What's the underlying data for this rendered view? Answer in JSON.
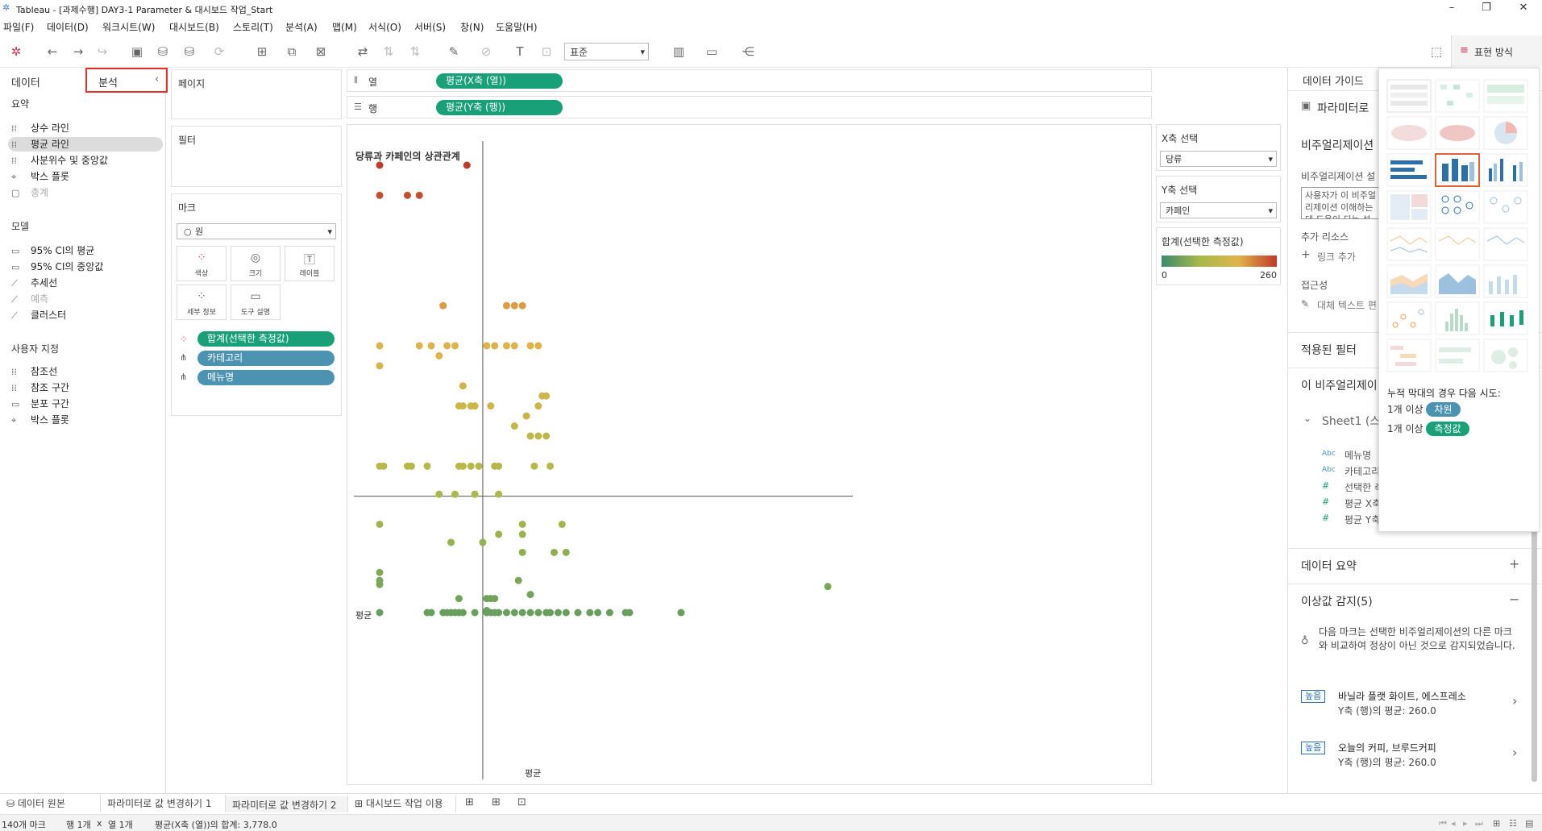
{
  "window": {
    "title": "Tableau - [과제수행] DAY3-1 Parameter & 대시보드 작업_Start"
  },
  "menu": [
    "파일(F)",
    "데이터(D)",
    "워크시트(W)",
    "대시보드(B)",
    "스토리(T)",
    "분석(A)",
    "맵(M)",
    "서식(O)",
    "서버(S)",
    "창(N)",
    "도움말(H)"
  ],
  "toolbar": {
    "fit_select": "표준",
    "show_me_label": "표현 방식"
  },
  "left_panel": {
    "tab_data": "데이터",
    "tab_analysis": "분석",
    "sections": [
      {
        "title": "요약",
        "items": [
          "상수 라인",
          "평균 라인",
          "사분위수 및 중앙값",
          "박스 플롯",
          "총계"
        ]
      },
      {
        "title": "모델",
        "items": [
          "95% CI의 평균",
          "95% CI의 중앙값",
          "추세선",
          "예측",
          "클러스터"
        ]
      },
      {
        "title": "사용자 지정",
        "items": [
          "참조선",
          "참조 구간",
          "분포 구간",
          "박스 플롯"
        ]
      }
    ]
  },
  "cards": {
    "pages_title": "페이지",
    "filters_title": "필터",
    "marks_title": "마크",
    "mark_type": "원",
    "mark_buttons": [
      "색상",
      "크기",
      "레이블",
      "세부 정보",
      "도구 설명"
    ],
    "mark_pills": [
      "합계(선택한 측정값)",
      "카테고리",
      "메뉴명"
    ]
  },
  "shelves": {
    "columns_label": "열",
    "rows_label": "행",
    "columns_pill": "평균(X축 (열))",
    "rows_pill": "평균(Y축 (행))"
  },
  "viz": {
    "title": "당류과 카페인의 상관관계",
    "avg_label_h": "평균",
    "avg_label_v": "평균"
  },
  "chart_data": {
    "type": "scatter",
    "title": "당류과 카페인의 상관관계",
    "xlabel": "",
    "ylabel": "",
    "reference_lines": {
      "horizontal": "평균",
      "vertical": "평균"
    },
    "color_legend": {
      "title": "합계(선택한 측정값)",
      "min": 0,
      "max": 260,
      "colors": [
        "#3a8a6e",
        "#a7b94a",
        "#e0b44a",
        "#c0392b"
      ]
    },
    "points": [
      [
        0,
        260
      ],
      [
        22,
        260
      ],
      [
        0,
        245
      ],
      [
        7,
        245
      ],
      [
        10,
        245
      ],
      [
        16,
        190
      ],
      [
        32,
        190
      ],
      [
        34,
        190
      ],
      [
        36,
        190
      ],
      [
        0,
        170
      ],
      [
        10,
        170
      ],
      [
        13,
        170
      ],
      [
        15,
        165
      ],
      [
        17,
        170
      ],
      [
        19,
        170
      ],
      [
        27,
        170
      ],
      [
        29,
        170
      ],
      [
        32,
        170
      ],
      [
        34,
        170
      ],
      [
        38,
        170
      ],
      [
        40,
        170
      ],
      [
        0,
        160
      ],
      [
        21,
        150
      ],
      [
        20,
        140
      ],
      [
        21,
        140
      ],
      [
        23,
        140
      ],
      [
        24,
        140
      ],
      [
        28,
        140
      ],
      [
        37,
        135
      ],
      [
        40,
        140
      ],
      [
        41,
        145
      ],
      [
        42,
        145
      ],
      [
        34,
        130
      ],
      [
        38,
        125
      ],
      [
        40,
        125
      ],
      [
        42,
        125
      ],
      [
        0,
        110
      ],
      [
        1,
        110
      ],
      [
        7,
        110
      ],
      [
        8,
        110
      ],
      [
        12,
        110
      ],
      [
        20,
        110
      ],
      [
        21,
        110
      ],
      [
        23,
        110
      ],
      [
        25,
        110
      ],
      [
        29,
        110
      ],
      [
        30,
        110
      ],
      [
        39,
        110
      ],
      [
        43,
        110
      ],
      [
        15,
        96
      ],
      [
        19,
        96
      ],
      [
        24,
        96
      ],
      [
        30,
        96
      ],
      [
        0,
        81
      ],
      [
        36,
        81
      ],
      [
        46,
        81
      ],
      [
        30,
        76
      ],
      [
        36,
        76
      ],
      [
        18,
        72
      ],
      [
        26,
        72
      ],
      [
        36,
        67
      ],
      [
        44,
        67
      ],
      [
        47,
        67
      ],
      [
        0,
        57
      ],
      [
        0,
        53
      ],
      [
        0,
        51
      ],
      [
        35,
        53
      ],
      [
        113,
        50
      ],
      [
        38,
        46
      ],
      [
        20,
        44
      ],
      [
        27,
        44
      ],
      [
        28,
        44
      ],
      [
        29,
        44
      ],
      [
        27,
        38
      ],
      [
        0,
        37
      ],
      [
        12,
        37
      ],
      [
        13,
        37
      ],
      [
        16,
        37
      ],
      [
        17,
        37
      ],
      [
        18,
        37
      ],
      [
        19,
        37
      ],
      [
        20,
        37
      ],
      [
        21,
        37
      ],
      [
        24,
        37
      ],
      [
        27,
        37
      ],
      [
        28,
        37
      ],
      [
        29,
        37
      ],
      [
        30,
        37
      ],
      [
        32,
        37
      ],
      [
        34,
        37
      ],
      [
        36,
        37
      ],
      [
        38,
        37
      ],
      [
        40,
        37
      ],
      [
        42,
        37
      ],
      [
        43,
        37
      ],
      [
        45,
        37
      ],
      [
        47,
        37
      ],
      [
        50,
        37
      ],
      [
        53,
        37
      ],
      [
        55,
        37
      ],
      [
        58,
        37
      ],
      [
        62,
        37
      ],
      [
        63,
        37
      ],
      [
        76,
        37
      ]
    ],
    "avg_x": 26,
    "avg_y": 95,
    "xlim": [
      0,
      113
    ],
    "ylim": [
      37,
      260
    ]
  },
  "controls": {
    "x_title": "X축 선택",
    "x_value": "당류",
    "y_title": "Y축 선택",
    "y_value": "카페인",
    "legend_title": "합계(선택한 측정값)",
    "legend_min": "0",
    "legend_max": "260"
  },
  "guide": {
    "title": "데이터 가이드",
    "param_label": "파라미터로",
    "viz_title": "비주얼리제이션",
    "viz_desc_label": "비주얼리제이션 설",
    "viz_desc_placeholder": "사용자가 이 비주얼리제이션 이해하는 데 도움이 되는 설명을 입",
    "extra_res": "추가 리소스",
    "add_link": "링크 추가",
    "accessibility": "접근성",
    "alt_text": "대체 텍스트 편",
    "applied_filters": "적용된 필터",
    "this_viz": "이 비주얼리제이",
    "sheet": "Sheet1 (스",
    "fields": [
      "메뉴명",
      "카테고리",
      "선택한 측",
      "평균 X축",
      "평균 Y축"
    ],
    "data_summary": "데이터 요약",
    "outliers_title": "이상값 감지(5)",
    "outliers_desc": "다음 마크는 선택한 비주얼리제이션의 다른 마크와 비교하여 정상이 아닌 것으로 감지되었습니다.",
    "outlier_items": [
      {
        "badge": "높음",
        "name": "바닐라 플랫 화이트, 에스프레소",
        "detail": "Y축 (행)의 평균: 260.0"
      },
      {
        "badge": "높음",
        "name": "오늘의 커피, 브루드커피",
        "detail": "Y축 (행)의 평균: 260.0"
      }
    ]
  },
  "show_me": {
    "hint": "누적 막대의 경우 다음 시도:",
    "line1_prefix": "1개 이상",
    "line1_chip": "차원",
    "line2_prefix": "1개 이상",
    "line2_chip": "측정값"
  },
  "tabs": [
    "데이터 원본",
    "파라미터로 값 변경하기 1",
    "파라미터로 값 변경하기 2",
    "대시보드 작업 이용"
  ],
  "status": {
    "marks": "140개 마크",
    "rows": "행 1개",
    "x": "x",
    "cols": "열 1개",
    "sum": "평균(X축 (열))의 합계: 3,778.0"
  }
}
